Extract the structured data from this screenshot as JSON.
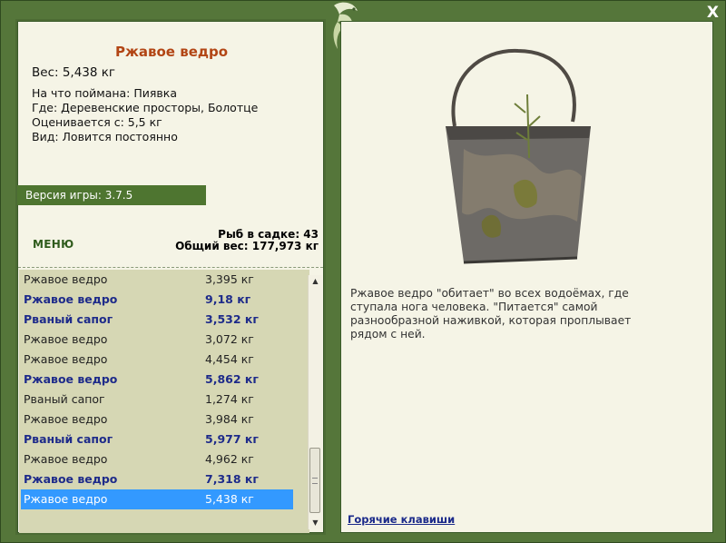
{
  "window": {
    "close_label": "X"
  },
  "fish": {
    "name": "Ржавое ведро",
    "weight": "Вес: 5,438 кг",
    "caught_on": "На что поймана: Пиявка",
    "location": "Где: Деревенские просторы, Болотце",
    "value": "Оценивается с: 5,5 кг",
    "kind": "Вид: Ловится постоянно",
    "description": "Ржавое ведро \"обитает\" во всех водоёмах, где ступала нога человека. \"Питается\" самой разнообразной наживкой, которая проплывает рядом с ней."
  },
  "version": "Версия игры: 3.7.5",
  "menu_label": "МЕНЮ",
  "stats": {
    "in_cage": "Рыб в садке: 43",
    "total_weight": "Общий вес: 177,973 кг"
  },
  "catch_list": [
    {
      "name": "Ржавое ведро",
      "weight": "3,395 кг",
      "bold": false,
      "selected": false
    },
    {
      "name": "Ржавое ведро",
      "weight": "9,18 кг",
      "bold": true,
      "selected": false
    },
    {
      "name": "Рваный сапог",
      "weight": "3,532 кг",
      "bold": true,
      "selected": false
    },
    {
      "name": "Ржавое ведро",
      "weight": "3,072 кг",
      "bold": false,
      "selected": false
    },
    {
      "name": "Ржавое ведро",
      "weight": "4,454 кг",
      "bold": false,
      "selected": false
    },
    {
      "name": "Ржавое ведро",
      "weight": "5,862 кг",
      "bold": true,
      "selected": false
    },
    {
      "name": "Рваный сапог",
      "weight": "1,274 кг",
      "bold": false,
      "selected": false
    },
    {
      "name": "Ржавое ведро",
      "weight": "3,984 кг",
      "bold": false,
      "selected": false
    },
    {
      "name": "Рваный сапог",
      "weight": "5,977 кг",
      "bold": true,
      "selected": false
    },
    {
      "name": "Ржавое ведро",
      "weight": "4,962 кг",
      "bold": false,
      "selected": false
    },
    {
      "name": "Ржавое ведро",
      "weight": "7,318 кг",
      "bold": true,
      "selected": false
    },
    {
      "name": "Ржавое ведро",
      "weight": "5,438 кг",
      "bold": false,
      "selected": true
    }
  ],
  "hotkeys_label": "Горячие клавиши",
  "icons": {
    "close": "close-icon",
    "emblem": "leaf-emblem-icon",
    "scroll_up": "arrow-up-icon",
    "scroll_down": "arrow-down-icon"
  }
}
